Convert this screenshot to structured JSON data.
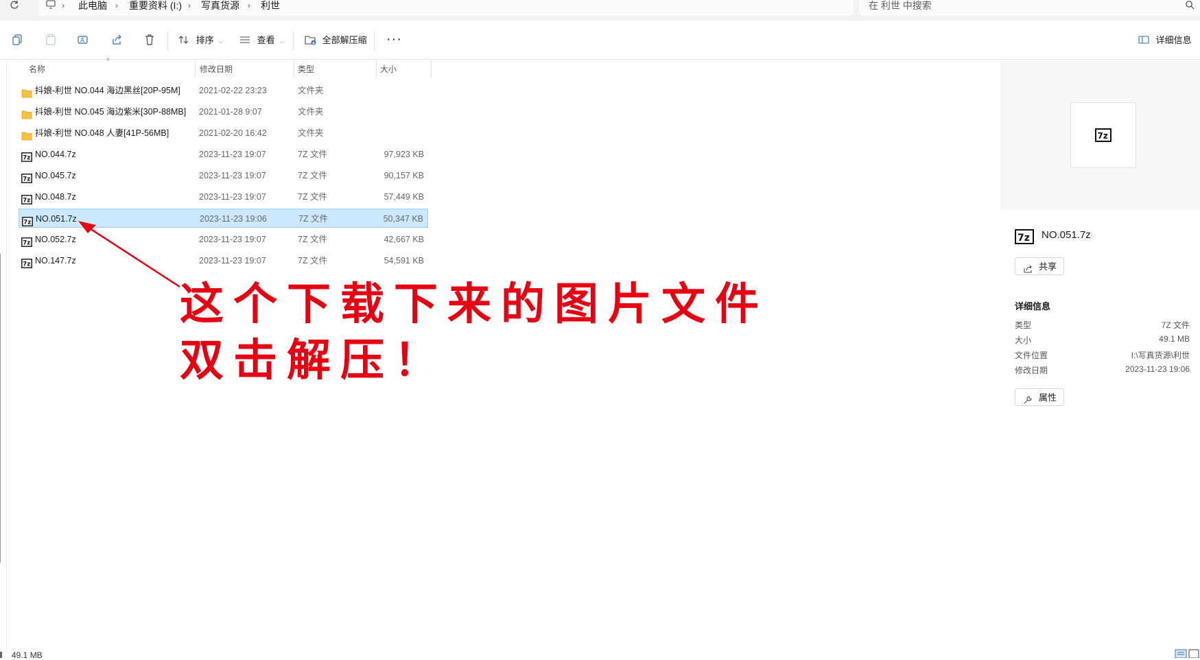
{
  "breadcrumb": {
    "items": [
      "此电脑",
      "重要资料 (I:)",
      "写真货源",
      "利世"
    ]
  },
  "search": {
    "placeholder": "在 利世 中搜索"
  },
  "toolbar": {
    "sort_label": "排序",
    "view_label": "查看",
    "extract_all_label": "全部解压缩",
    "details_label": "详细信息"
  },
  "columns": {
    "name": "名称",
    "modified": "修改日期",
    "type": "类型",
    "size": "大小"
  },
  "files": [
    {
      "name": "抖娘-利世 NO.044 海边黑丝[20P-95M]",
      "date": "2021-02-22 23:23",
      "type": "文件夹",
      "size": "",
      "kind": "folder"
    },
    {
      "name": "抖娘-利世 NO.045 海边紫米[30P-88MB]",
      "date": "2021-01-28 9:07",
      "type": "文件夹",
      "size": "",
      "kind": "folder"
    },
    {
      "name": "抖娘-利世 NO.048 人妻[41P-56MB]",
      "date": "2021-02-20 16:42",
      "type": "文件夹",
      "size": "",
      "kind": "folder"
    },
    {
      "name": "NO.044.7z",
      "date": "2023-11-23 19:07",
      "type": "7Z 文件",
      "size": "97,923 KB",
      "kind": "7z"
    },
    {
      "name": "NO.045.7z",
      "date": "2023-11-23 19:07",
      "type": "7Z 文件",
      "size": "90,157 KB",
      "kind": "7z"
    },
    {
      "name": "NO.048.7z",
      "date": "2023-11-23 19:07",
      "type": "7Z 文件",
      "size": "57,449 KB",
      "kind": "7z"
    },
    {
      "name": "NO.051.7z",
      "date": "2023-11-23 19:06",
      "type": "7Z 文件",
      "size": "50,347 KB",
      "kind": "7z",
      "selected": true
    },
    {
      "name": "NO.052.7z",
      "date": "2023-11-23 19:07",
      "type": "7Z 文件",
      "size": "42,667 KB",
      "kind": "7z"
    },
    {
      "name": "NO.147.7z",
      "date": "2023-11-23 19:07",
      "type": "7Z 文件",
      "size": "54,591 KB",
      "kind": "7z"
    }
  ],
  "annotation": {
    "line1": "这个下载下来的图片文件",
    "line2": "双击解压！",
    "color": "#e60012"
  },
  "details": {
    "file_name": "NO.051.7z",
    "share_label": "共享",
    "heading": "详细信息",
    "rows": [
      {
        "key": "类型",
        "value": "7Z 文件"
      },
      {
        "key": "大小",
        "value": "49.1 MB"
      },
      {
        "key": "文件位置",
        "value": "I:\\写真货源\\利世"
      },
      {
        "key": "修改日期",
        "value": "2023-11-23 19:06"
      }
    ],
    "properties_label": "属性"
  },
  "status": {
    "text": "49.1 MB"
  },
  "colors": {
    "selection_bg": "#cce8ff",
    "selection_border": "#99d1ff",
    "folder": "#f5c242"
  }
}
